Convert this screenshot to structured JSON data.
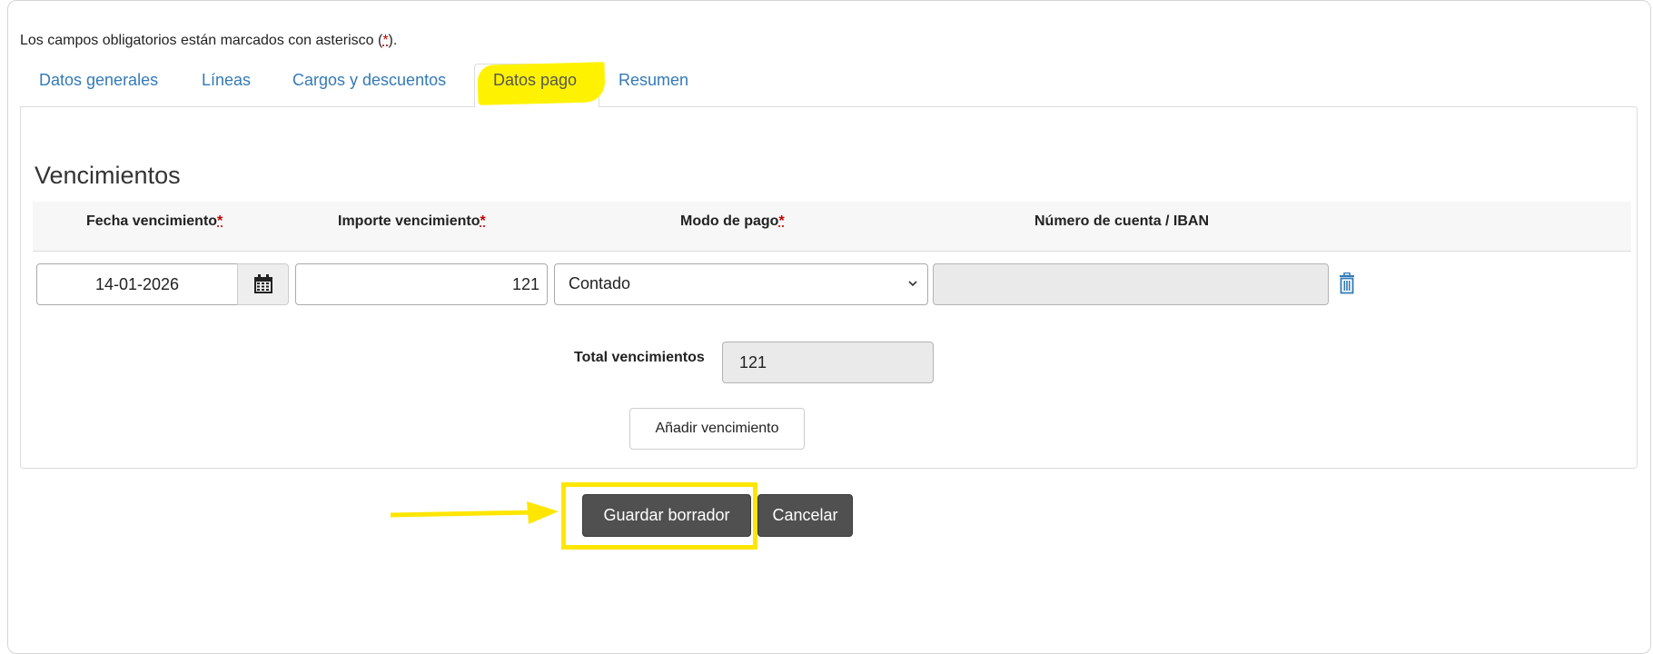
{
  "notice": {
    "text_before": "Los campos obligatorios están marcados con asterisco (",
    "star": "*",
    "text_after": ")."
  },
  "tabs": [
    {
      "label": "Datos generales"
    },
    {
      "label": "Líneas"
    },
    {
      "label": "Cargos y descuentos"
    },
    {
      "label": "Datos pago",
      "active": true
    },
    {
      "label": "Resumen"
    }
  ],
  "section": {
    "title": "Vencimientos"
  },
  "table": {
    "headers": [
      {
        "label": "Fecha vencimiento",
        "required": "*"
      },
      {
        "label": "Importe vencimiento",
        "required": "*"
      },
      {
        "label": "Modo de pago",
        "required": "*"
      },
      {
        "label": "Número de cuenta / IBAN",
        "required": ""
      }
    ],
    "row": {
      "date": "14-01-2026",
      "amount": "121",
      "payment_mode": "Contado",
      "iban": ""
    }
  },
  "total": {
    "label": "Total vencimientos",
    "value": "121"
  },
  "add_button": "Añadir vencimiento",
  "actions": {
    "save": "Guardar borrador",
    "cancel": "Cancelar"
  },
  "colors": {
    "link": "#337ab7",
    "highlight": "#fff200",
    "dark_button": "#505050",
    "required": "#c00000"
  },
  "icons": [
    "calendar-icon",
    "chevron-down-icon",
    "trash-icon",
    "arrow-right-icon"
  ]
}
